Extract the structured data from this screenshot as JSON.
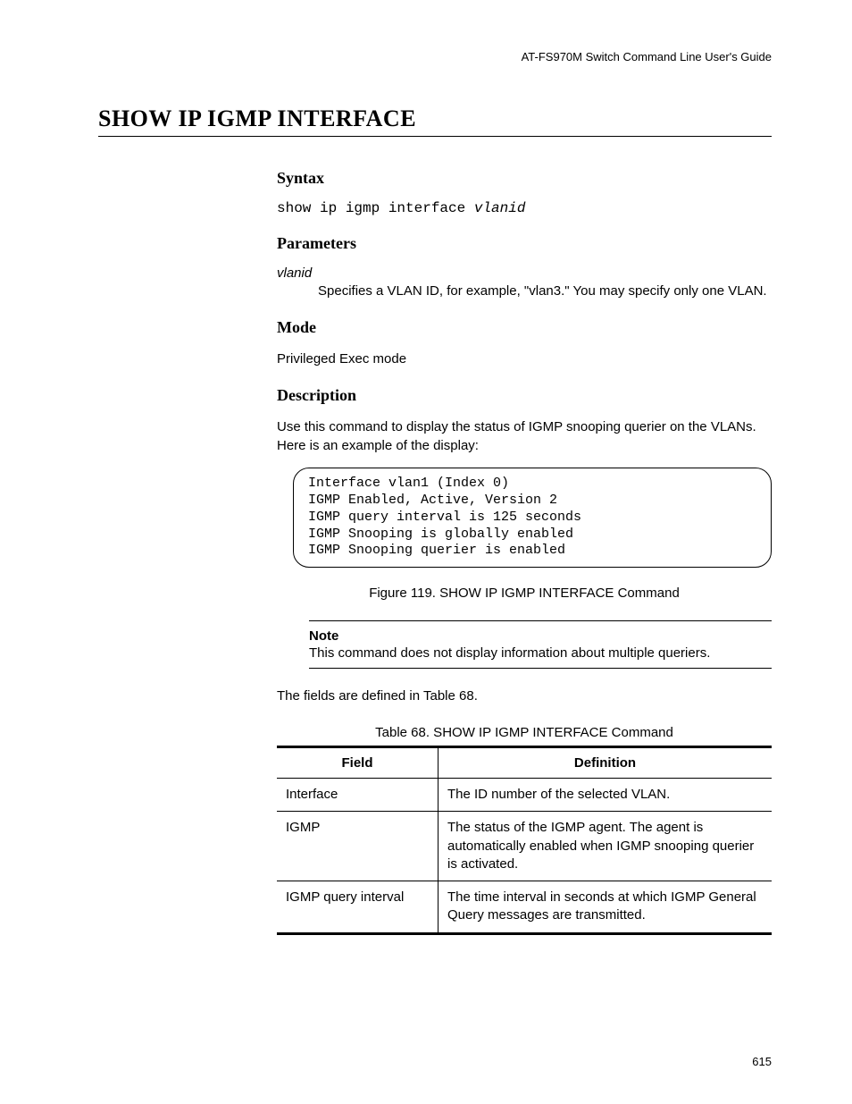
{
  "header": {
    "guide_title": "AT-FS970M Switch Command Line User's Guide"
  },
  "title": "SHOW IP IGMP INTERFACE",
  "sections": {
    "syntax": {
      "heading": "Syntax",
      "command": "show ip igmp interface ",
      "arg": "vlanid"
    },
    "parameters": {
      "heading": "Parameters",
      "param_name": "vlanid",
      "param_desc": "Specifies a VLAN ID, for example, \"vlan3.\" You may specify only one VLAN."
    },
    "mode": {
      "heading": "Mode",
      "text": "Privileged Exec mode"
    },
    "description": {
      "heading": "Description",
      "intro": "Use this command to display the status of IGMP snooping querier on the VLANs. Here is an example of the display:",
      "example": "Interface vlan1 (Index 0)\nIGMP Enabled, Active, Version 2\nIGMP query interval is 125 seconds\nIGMP Snooping is globally enabled\nIGMP Snooping querier is enabled",
      "figure_caption": "Figure 119. SHOW IP IGMP INTERFACE Command",
      "note_label": "Note",
      "note_text": "This command does not display information about multiple queriers.",
      "fields_intro": "The fields are defined in Table 68.",
      "table_caption": "Table 68. SHOW IP IGMP INTERFACE Command",
      "table": {
        "head_field": "Field",
        "head_def": "Definition",
        "rows": [
          {
            "field": "Interface",
            "def": "The ID number of the selected VLAN."
          },
          {
            "field": "IGMP",
            "def": "The status of the IGMP agent. The agent is automatically enabled when IGMP snooping querier is activated."
          },
          {
            "field": "IGMP query interval",
            "def": "The time interval in seconds at which IGMP General Query messages are transmitted."
          }
        ]
      }
    }
  },
  "page_number": "615"
}
